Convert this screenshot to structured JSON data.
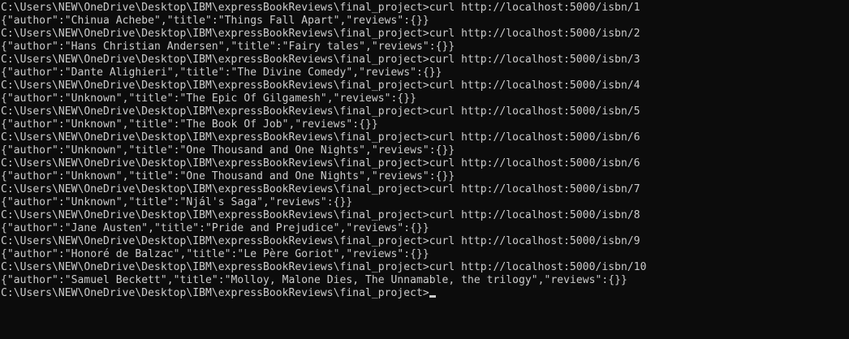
{
  "terminal": {
    "prompt": "C:\\Users\\NEW\\OneDrive\\Desktop\\IBM\\expressBookReviews\\final_project>",
    "entries": [
      {
        "command": "curl http://localhost:5000/isbn/1",
        "output": "{\"author\":\"Chinua Achebe\",\"title\":\"Things Fall Apart\",\"reviews\":{}}"
      },
      {
        "command": "curl http://localhost:5000/isbn/2",
        "output": "{\"author\":\"Hans Christian Andersen\",\"title\":\"Fairy tales\",\"reviews\":{}}"
      },
      {
        "command": "curl http://localhost:5000/isbn/3",
        "output": "{\"author\":\"Dante Alighieri\",\"title\":\"The Divine Comedy\",\"reviews\":{}}"
      },
      {
        "command": "curl http://localhost:5000/isbn/4",
        "output": "{\"author\":\"Unknown\",\"title\":\"The Epic Of Gilgamesh\",\"reviews\":{}}"
      },
      {
        "command": "curl http://localhost:5000/isbn/5",
        "output": "{\"author\":\"Unknown\",\"title\":\"The Book Of Job\",\"reviews\":{}}"
      },
      {
        "command": "curl http://localhost:5000/isbn/6",
        "output": "{\"author\":\"Unknown\",\"title\":\"One Thousand and One Nights\",\"reviews\":{}}"
      },
      {
        "command": "curl http://localhost:5000/isbn/6",
        "output": "{\"author\":\"Unknown\",\"title\":\"One Thousand and One Nights\",\"reviews\":{}}"
      },
      {
        "command": "curl http://localhost:5000/isbn/7",
        "output": "{\"author\":\"Unknown\",\"title\":\"Njál's Saga\",\"reviews\":{}}"
      },
      {
        "command": "curl http://localhost:5000/isbn/8",
        "output": "{\"author\":\"Jane Austen\",\"title\":\"Pride and Prejudice\",\"reviews\":{}}"
      },
      {
        "command": "curl http://localhost:5000/isbn/9",
        "output": "{\"author\":\"Honoré de Balzac\",\"title\":\"Le Père Goriot\",\"reviews\":{}}"
      },
      {
        "command": "curl http://localhost:5000/isbn/10",
        "output": "{\"author\":\"Samuel Beckett\",\"title\":\"Molloy, Malone Dies, The Unnamable, the trilogy\",\"reviews\":{}}"
      }
    ],
    "current_input": "",
    "colors": {
      "background": "#0c0c0c",
      "foreground": "#cccccc"
    }
  }
}
